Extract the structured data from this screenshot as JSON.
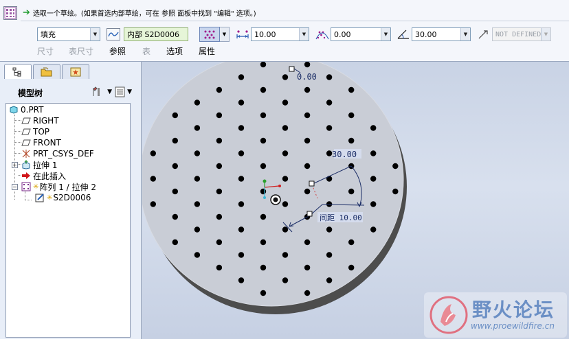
{
  "dashboard": {
    "prompt": "选取一个草绘。(如果首选内部草绘，可在 参照 面板中找到 \"编辑\" 选项。)",
    "fill_mode": "填充",
    "section_name": "内部 S2D0006",
    "spacing_value": "10.00",
    "offset_value": "0.00",
    "angle_value": "30.00",
    "extra_value": "NOT DEFINED"
  },
  "tabs": [
    "尺寸",
    "表尺寸",
    "参照",
    "表",
    "选项",
    "属性"
  ],
  "tabs_disabled": [
    true,
    true,
    false,
    true,
    false,
    false
  ],
  "model_tree": {
    "title": "模型树",
    "nodes": [
      {
        "label": "0.PRT",
        "icon": "part-icon"
      },
      {
        "label": "RIGHT",
        "icon": "datum-plane-icon"
      },
      {
        "label": "TOP",
        "icon": "datum-plane-icon"
      },
      {
        "label": "FRONT",
        "icon": "datum-plane-icon"
      },
      {
        "label": "PRT_CSYS_DEF",
        "icon": "csys-icon"
      },
      {
        "label": "拉伸 1",
        "icon": "extrude-icon"
      },
      {
        "label": "在此插入",
        "icon": "insert-here-icon"
      },
      {
        "label": "阵列 1 / 拉伸 2",
        "icon": "pattern-icon"
      },
      {
        "label": "S2D0006",
        "icon": "sketch-icon"
      }
    ]
  },
  "viewport": {
    "dim_top": "0.00",
    "dim_angle": "30.00",
    "dim_spacing": "间距 10.00"
  },
  "watermark": {
    "title": "野火论坛",
    "url": "www.proewildfire.cn"
  }
}
